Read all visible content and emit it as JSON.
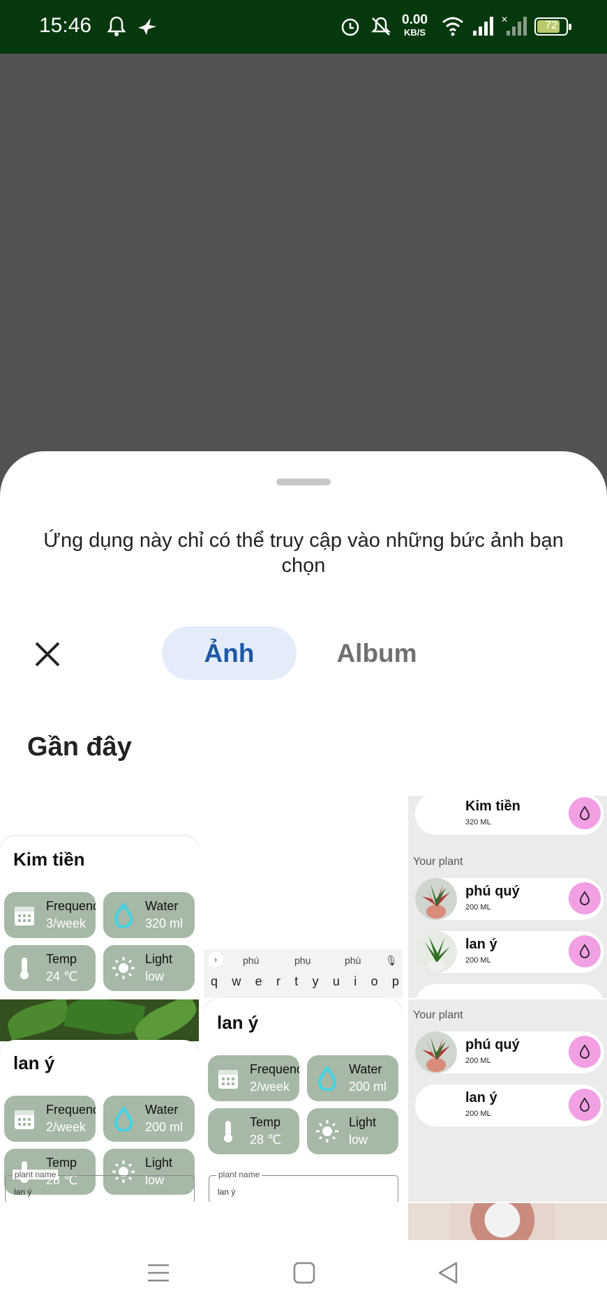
{
  "status_bar": {
    "time": "15:46",
    "speed_value": "0.00",
    "speed_unit": "KB/S",
    "battery": "72",
    "icons": [
      "bell-icon",
      "bird-icon",
      "alarm-icon",
      "mute-icon",
      "wifi-icon",
      "signal-icon",
      "signal-off-icon",
      "battery-icon"
    ]
  },
  "sheet": {
    "notice": "Ứng dụng này chỉ có thể truy cập vào những bức ảnh bạn chọn",
    "tabs": [
      {
        "label": "Ảnh",
        "selected": true
      },
      {
        "label": "Album",
        "selected": false
      }
    ],
    "section_title": "Gần đây"
  },
  "thumbnails": {
    "card_kim_tien": {
      "name": "Kim tiền",
      "frequency_label": "Frequency",
      "frequency_value": "3/week",
      "water_label": "Water",
      "water_value": "320 ml",
      "temp_label": "Temp",
      "temp_value": "24 ℃",
      "light_label": "Light",
      "light_value": "low"
    },
    "keyboard": {
      "suggestions": [
        "phú",
        "phụ",
        "phù"
      ],
      "keys": [
        "q",
        "w",
        "e",
        "r",
        "t",
        "y",
        "u",
        "i",
        "o",
        "p"
      ]
    },
    "list_top": {
      "rows": [
        {
          "name": "Kim tiền",
          "amount": "320 ML"
        },
        {
          "name": "phú quý",
          "amount": "200 ML"
        },
        {
          "name": "lan ý",
          "amount": "200 ML"
        }
      ],
      "section_label": "Your plant"
    },
    "card_lan_y_1": {
      "name": "lan ý",
      "frequency_label": "Frequency",
      "frequency_value": "2/week",
      "water_label": "Water",
      "water_value": "200 ml",
      "temp_label": "Temp",
      "temp_value": "28 ℃",
      "light_label": "Light",
      "light_value": "low",
      "field_label": "plant name",
      "field_value": "lan ý"
    },
    "card_lan_y_2": {
      "name": "lan ý",
      "frequency_label": "Frequency",
      "frequency_value": "2/week",
      "water_label": "Water",
      "water_value": "200 ml",
      "temp_label": "Temp",
      "temp_value": "28 ℃",
      "light_label": "Light",
      "light_value": "low",
      "field_label": "plant name",
      "field_value": "lan ý"
    },
    "list_bottom": {
      "section_label": "Your plant",
      "rows": [
        {
          "name": "phú quý",
          "amount": "200 ML"
        },
        {
          "name": "lan ý",
          "amount": "200 ML"
        }
      ]
    }
  },
  "colors": {
    "status_bar": "#06380d",
    "tab_selected_bg": "#e3ecf8",
    "tab_selected_text": "#1d57a6",
    "chip_bg": "#a6b8a6",
    "water_drop": "#f29fe3"
  }
}
